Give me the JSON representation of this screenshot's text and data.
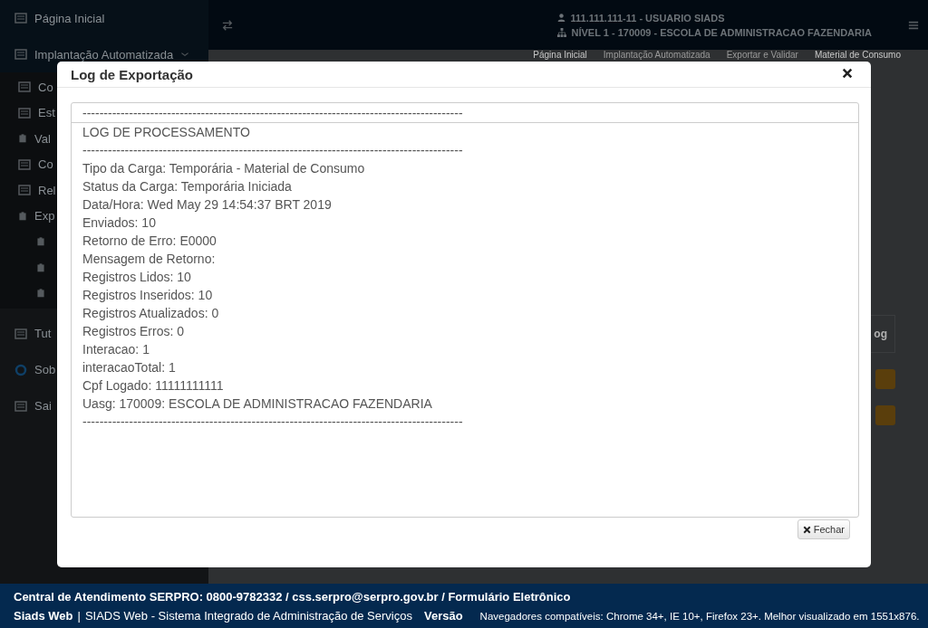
{
  "sidebar": {
    "items": [
      {
        "label": "Página Inicial"
      },
      {
        "label": "Implantação Automatizada",
        "expanded": true,
        "children": [
          {
            "label": "Co"
          },
          {
            "label": "Est"
          },
          {
            "label": "Val"
          },
          {
            "label": "Co"
          },
          {
            "label": "Rel"
          },
          {
            "label": "Exp"
          }
        ]
      },
      {
        "label": "Tut"
      },
      {
        "label": "Sob"
      },
      {
        "label": "Sai"
      }
    ]
  },
  "header": {
    "user": "111.111.111-11 - USUARIO SIADS",
    "level": "NÍVEL 1 - 170009 - ESCOLA DE ADMINISTRACAO FAZENDARIA"
  },
  "breadcrumb": [
    "Página Inicial",
    "Implantação Automatizada",
    "Exportar e Validar",
    "Material de Consumo"
  ],
  "table": {
    "column_1": "og"
  },
  "modal": {
    "title": "Log de Exportação",
    "log_lines": [
      "------------------------------------------------------------------------------------------",
      "LOG DE PROCESSAMENTO",
      "------------------------------------------------------------------------------------------",
      "Tipo da Carga: Temporária - Material de Consumo",
      "Status da Carga: Temporária Iniciada",
      "Data/Hora: Wed May 29 14:54:37 BRT 2019",
      "Enviados: 10",
      "Retorno de Erro: E0000",
      "Mensagem de Retorno:",
      "Registros Lidos: 10",
      "Registros Inseridos: 10",
      "Registros Atualizados: 0",
      "Registros Erros: 0",
      "Interacao: 1",
      "interacaoTotal: 1",
      "Cpf Logado: 11111111111",
      "Uasg: 170009: ESCOLA DE ADMINISTRACAO FAZENDARIA",
      "------------------------------------------------------------------------------------------"
    ],
    "close_button": "Fechar"
  },
  "footer": {
    "contact": "Central de Atendimento SERPRO: 0800-9782332 / css.serpro@serpro.gov.br / Formulário Eletrônico",
    "brand": "Siads Web",
    "separator": "|",
    "system": "SIADS Web - Sistema Integrado de Administração de Serviços",
    "version": "Versão",
    "browsers": "Navegadores compatíveis: Chrome 34+, IE 10+, Firefox 23+. Melhor visualizado em 1551x876."
  }
}
